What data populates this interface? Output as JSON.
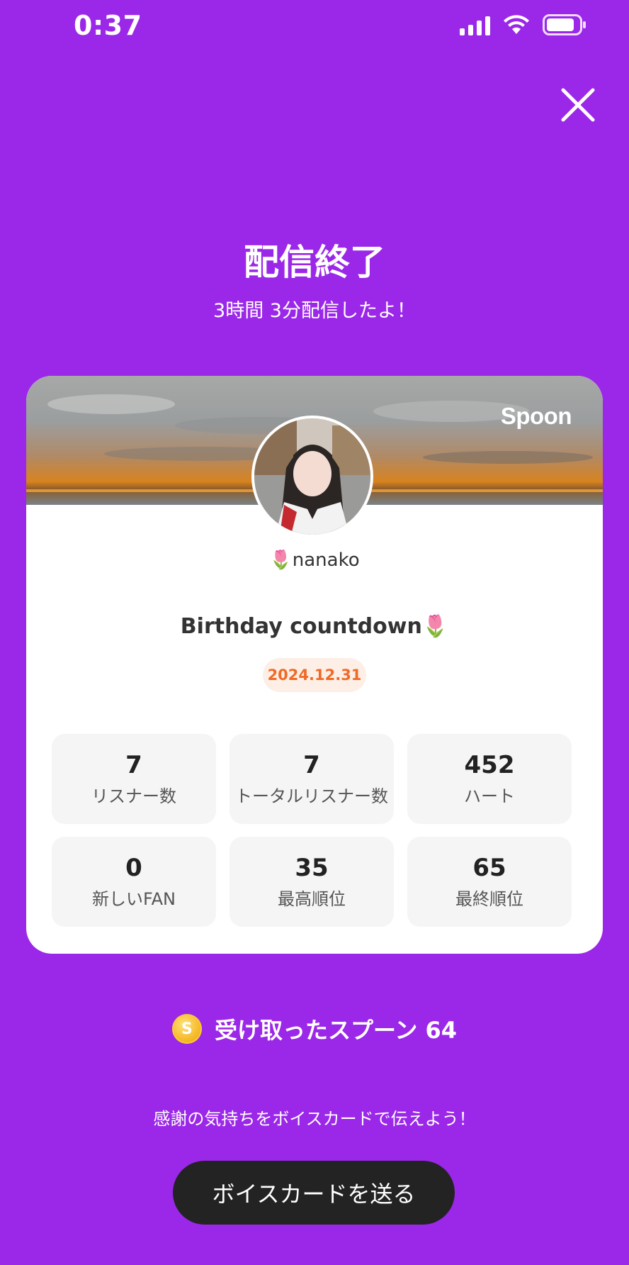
{
  "status_bar": {
    "time": "0:37"
  },
  "header": {
    "title": "配信終了",
    "subtitle": "3時間 3分配信したよ！"
  },
  "card": {
    "brand": "Spoon",
    "username": "🌷nanako",
    "live_title": "Birthday countdown🌷",
    "date": "2024.12.31",
    "stats": [
      {
        "value": "7",
        "label": "リスナー数"
      },
      {
        "value": "7",
        "label": "トータルリスナー数"
      },
      {
        "value": "452",
        "label": "ハート"
      },
      {
        "value": "0",
        "label": "新しいFAN"
      },
      {
        "value": "35",
        "label": "最高順位"
      },
      {
        "value": "65",
        "label": "最終順位"
      }
    ]
  },
  "spoons": {
    "coin_symbol": "S",
    "label": "受け取ったスプーン  64"
  },
  "footer": {
    "message": "感謝の気持ちをボイスカードで伝えよう！",
    "button_label": "ボイスカードを送る"
  },
  "icons": {
    "close": "close-icon",
    "signal": "signal-icon",
    "wifi": "wifi-icon",
    "battery": "battery-icon"
  },
  "colors": {
    "background": "#9B27E8",
    "badge_text": "#F06A26",
    "badge_bg": "#FDEEE6",
    "button_bg": "#232323"
  }
}
